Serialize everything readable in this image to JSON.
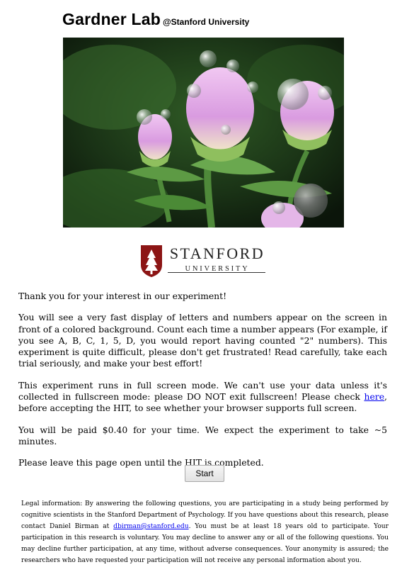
{
  "header": {
    "lab_name": "Gardner Lab",
    "affiliation": "@Stanford University"
  },
  "hero_image": {
    "subject": "pink flower buds with water droplets"
  },
  "logo": {
    "line1": "STANFORD",
    "line2": "UNIVERSITY",
    "colors": {
      "shield": "#8c1515",
      "tree": "#ffffff"
    }
  },
  "content": {
    "thanks": "Thank you for your interest in our experiment!",
    "instructions": "You will see a very fast display of letters and numbers appear on the screen in front of a colored background. Count each time a number appears (For example, if you see A, B, C, 1, 5, D, you would report having counted \"2\" numbers). This experiment is quite difficult, please don't get frustrated! Read carefully, take each trial seriously, and make your best effort!",
    "fullscreen_before": "This experiment runs in full screen mode. We can't use your data unless it's collected in fullscreen mode: please DO NOT exit fullscreen! Please check ",
    "fullscreen_link": "here",
    "fullscreen_after": ", before accepting the HIT, to see whether your browser supports full screen.",
    "payment": "You will be paid $0.40 for your time. We expect the experiment to take ~5 minutes.",
    "leave_open": "Please leave this page open until the HIT is completed."
  },
  "start_button": {
    "label": "Start"
  },
  "legal": {
    "before": "Legal information: By answering the following questions, you are participating in a study being performed by cognitive scientists in the Stanford Department of Psychology. If you have questions about this research, please contact Daniel Birman at ",
    "email": "dbirman@stanford.edu",
    "after": ". You must be at least 18 years old to participate. Your participation in this research is voluntary. You may decline to answer any or all of the following questions. You may decline further participation, at any time, without adverse consequences. Your anonymity is assured; the researchers who have requested your participation will not receive any personal information about you."
  },
  "colors": {
    "link": "#0000ee",
    "button_border": "#a9a9a9"
  }
}
